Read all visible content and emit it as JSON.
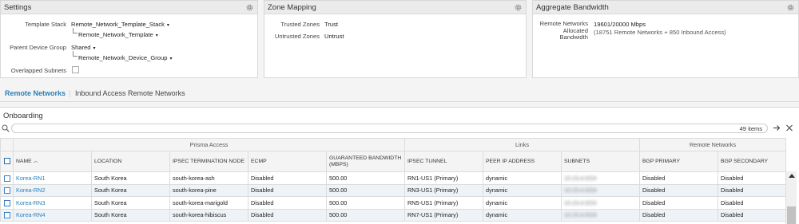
{
  "settings": {
    "title": "Settings",
    "template_stack_label": "Template Stack",
    "template_stack_value": "Remote_Network_Template_Stack",
    "template_value": "Remote_Network_Template",
    "parent_device_group_label": "Parent Device Group",
    "parent_device_group_value": "Shared",
    "device_group_value": "Remote_Network_Device_Group",
    "overlapped_subnets_label": "Overlapped Subnets",
    "caret": "▾"
  },
  "zone_mapping": {
    "title": "Zone Mapping",
    "trusted_label": "Trusted Zones",
    "trusted_value": "Trust",
    "untrusted_label": "Untrusted Zones",
    "untrusted_value": "Untrust"
  },
  "bandwidth": {
    "title": "Aggregate Bandwidth",
    "label_line1": "Remote Networks",
    "label_line2": "Allocated",
    "label_line3": "Bandwidth",
    "value": "19601/20000 Mbps",
    "detail": "(18751 Remote Networks + 850 Inbound Access)"
  },
  "tabs": {
    "remote_networks": "Remote Networks",
    "separator": "|",
    "inbound_access": "Inbound Access Remote Networks"
  },
  "onboarding": {
    "title": "Onboarding",
    "count": "49 items"
  },
  "table": {
    "groups": {
      "prisma_access": "Prisma Access",
      "links": "Links",
      "remote_networks": "Remote Networks"
    },
    "columns": {
      "name": "NAME",
      "location": "LOCATION",
      "ipsec_node": "IPSEC TERMINATION NODE",
      "ecmp": "ECMP",
      "bandwidth": "GUARANTEED BANDWIDTH (MBPS)",
      "ipsec_tunnel": "IPSEC TUNNEL",
      "peer_ip": "PEER IP ADDRESS",
      "subnets": "SUBNETS",
      "bgp_primary": "BGP PRIMARY",
      "bgp_secondary": "BGP SECONDARY"
    },
    "rows": [
      {
        "name": "Korea-RN1",
        "location": "South Korea",
        "node": "south-korea-ash",
        "ecmp": "Disabled",
        "bandwidth": "500.00",
        "tunnel": "RN1-US1 (Primary)",
        "peer": "dynamic",
        "subnets": "10.23.4.0/24",
        "bgp1": "Disabled",
        "bgp2": "Disabled"
      },
      {
        "name": "Korea-RN2",
        "location": "South Korea",
        "node": "south-korea-pine",
        "ecmp": "Disabled",
        "bandwidth": "500.00",
        "tunnel": "RN3-US1 (Primary)",
        "peer": "dynamic",
        "subnets": "10.23.4.0/24",
        "bgp1": "Disabled",
        "bgp2": "Disabled"
      },
      {
        "name": "Korea-RN3",
        "location": "South Korea",
        "node": "south-korea-marigold",
        "ecmp": "Disabled",
        "bandwidth": "500.00",
        "tunnel": "RN5-US1 (Primary)",
        "peer": "dynamic",
        "subnets": "10.23.4.0/24",
        "bgp1": "Disabled",
        "bgp2": "Disabled"
      },
      {
        "name": "Korea-RN4",
        "location": "South Korea",
        "node": "south-korea-hibiscus",
        "ecmp": "Disabled",
        "bandwidth": "500.00",
        "tunnel": "RN7-US1 (Primary)",
        "peer": "dynamic",
        "subnets": "10.23.4.0/24",
        "bgp1": "Disabled",
        "bgp2": "Disabled"
      }
    ]
  },
  "colors": {
    "accent": "#2a80b9",
    "header_bg": "#ebebeb",
    "row_alt": "#eef3f8"
  }
}
